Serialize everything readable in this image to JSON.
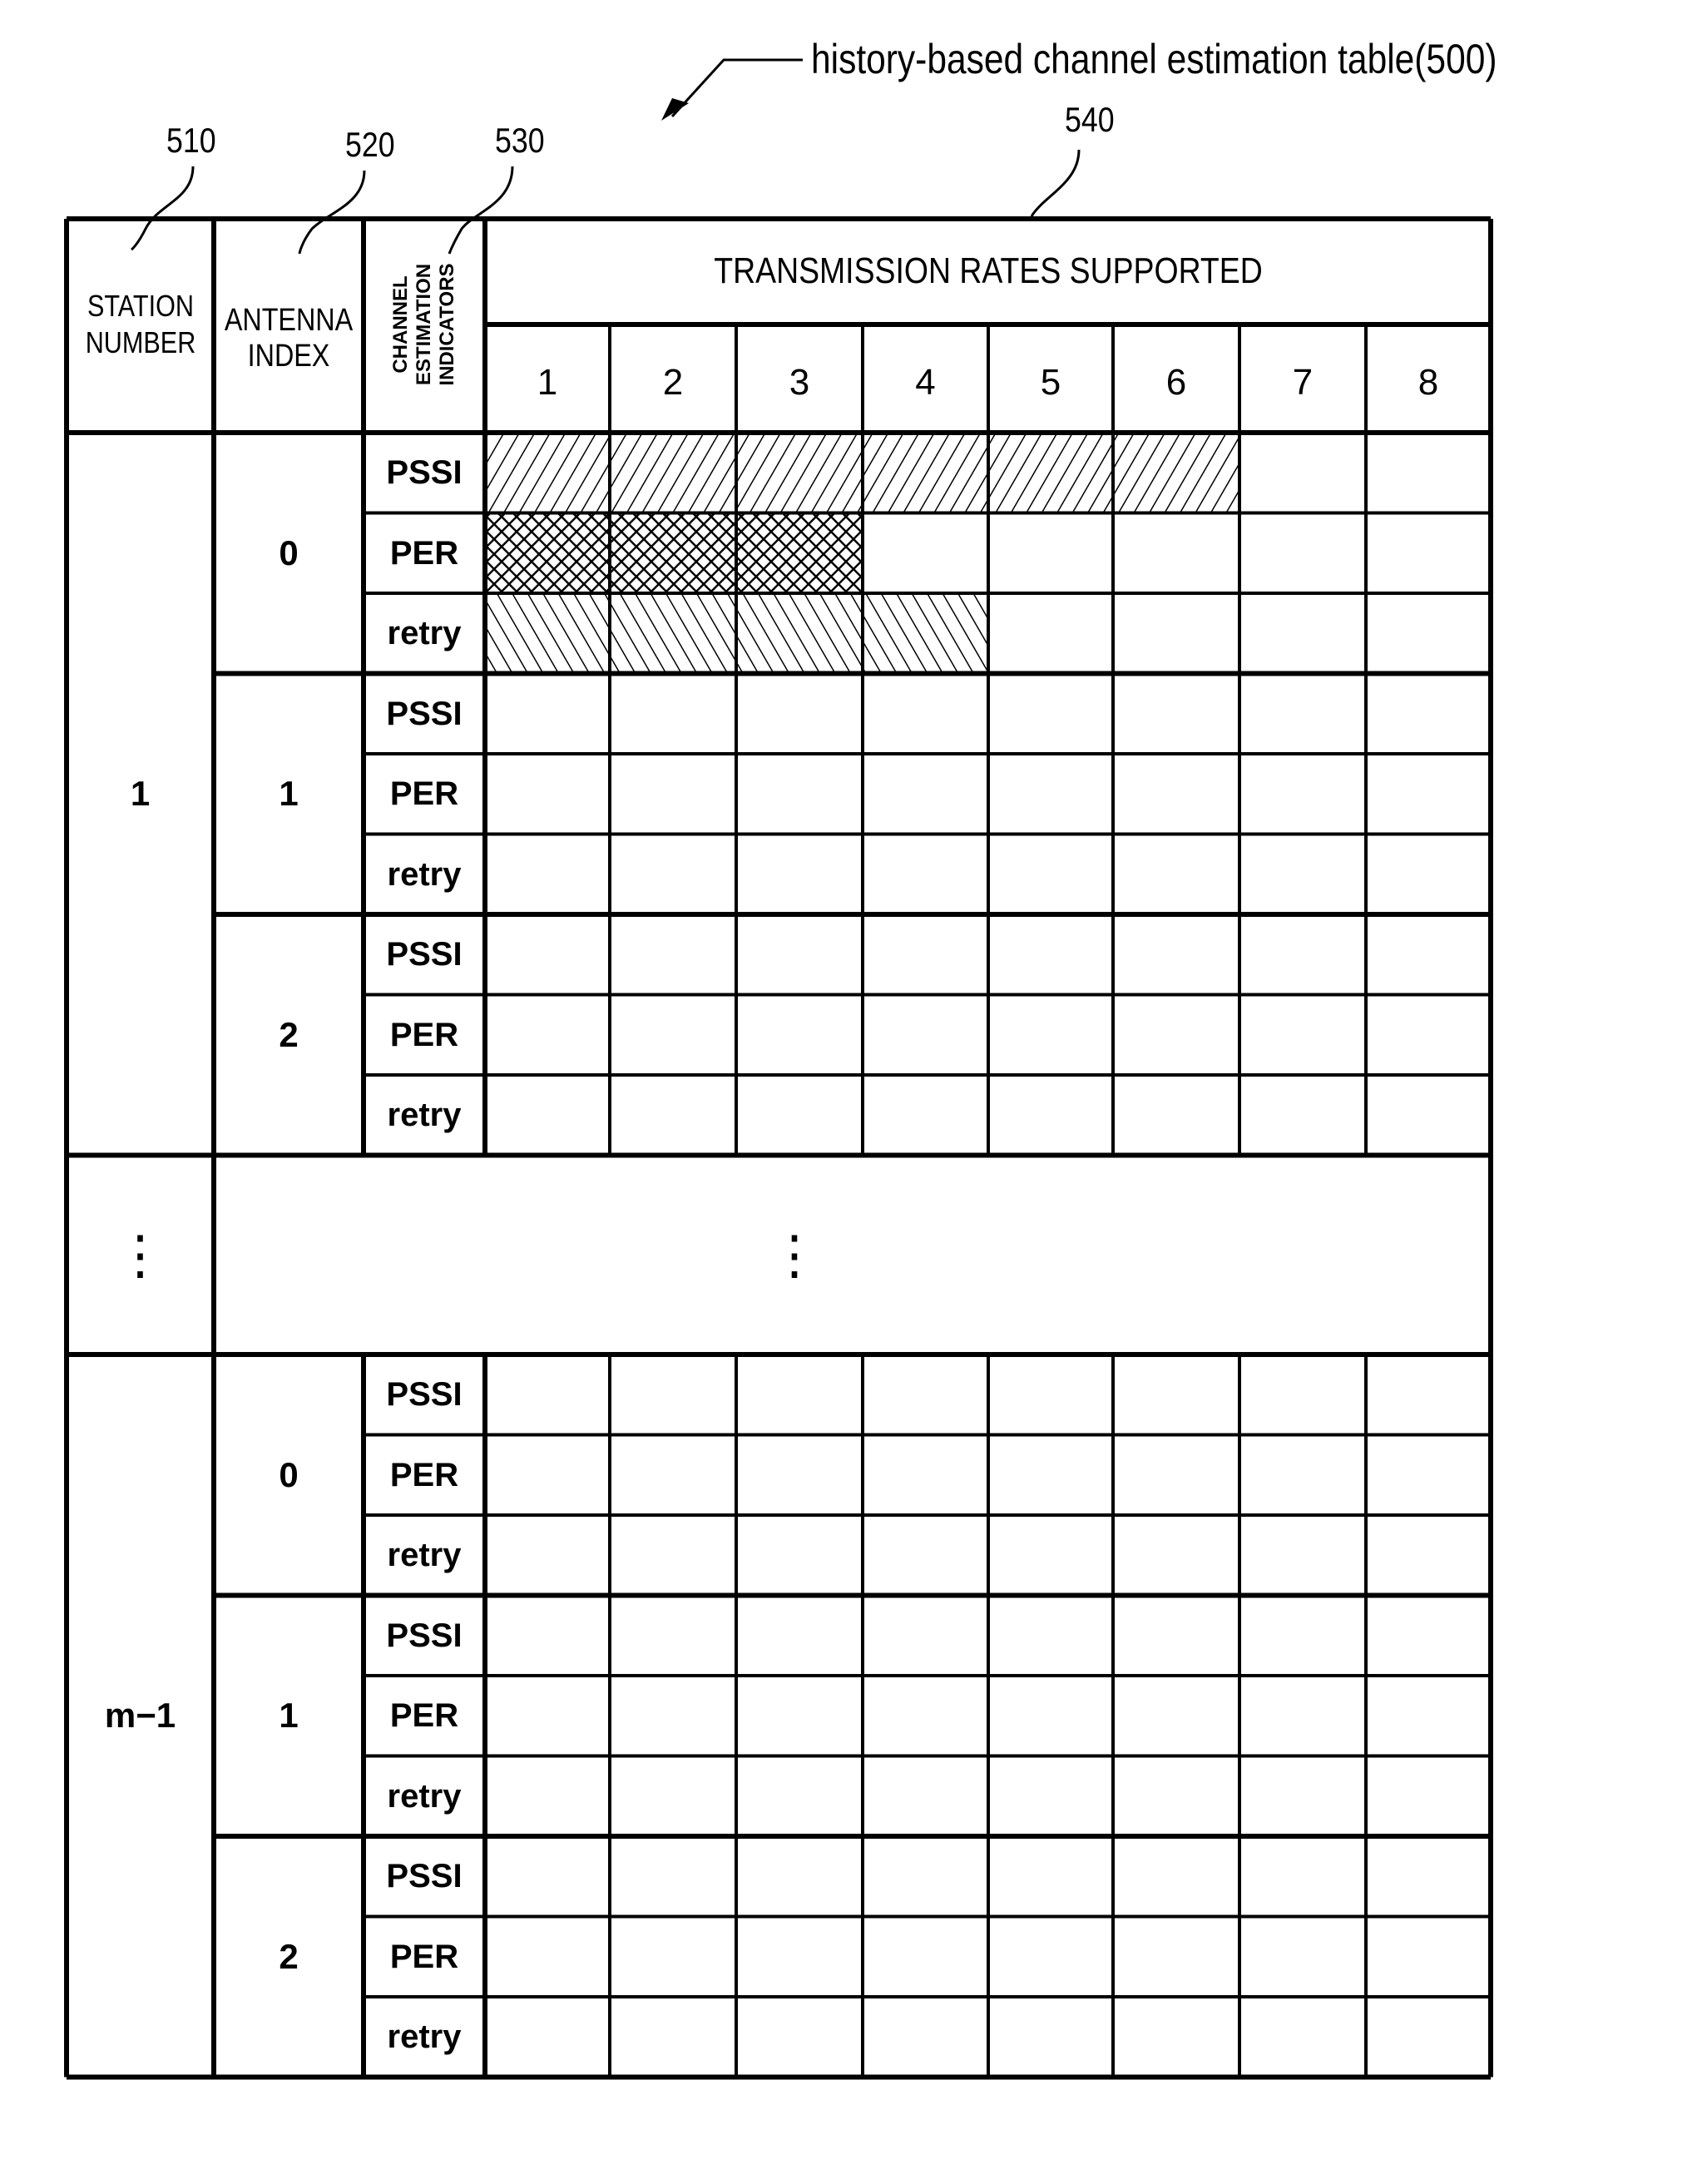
{
  "figure": {
    "title": "history-based channel estimation table(500)",
    "reference_labels": {
      "station": "510",
      "antenna": "520",
      "indicators": "530",
      "rates": "540"
    }
  },
  "table": {
    "headers": {
      "station": [
        "STATION",
        "NUMBER"
      ],
      "antenna": [
        "ANTENNA",
        "INDEX"
      ],
      "indicators": [
        "CHANNEL",
        "ESTIMATION",
        "INDICATORS"
      ],
      "rates_title": "TRANSMISSION RATES SUPPORTED",
      "rates": [
        "1",
        "2",
        "3",
        "4",
        "5",
        "6",
        "7",
        "8"
      ]
    },
    "indicator_names": [
      "PSSI",
      "PER",
      "retry"
    ],
    "ellipsis": "⋮",
    "stations": [
      {
        "label": "1",
        "antennas": [
          {
            "index": "0",
            "filled_rates": {
              "PSSI": 6,
              "PER": 3,
              "retry": 4
            }
          },
          {
            "index": "1",
            "filled_rates": {
              "PSSI": 0,
              "PER": 0,
              "retry": 0
            }
          },
          {
            "index": "2",
            "filled_rates": {
              "PSSI": 0,
              "PER": 0,
              "retry": 0
            }
          }
        ]
      },
      {
        "label": "m−1",
        "antennas": [
          {
            "index": "0",
            "filled_rates": {
              "PSSI": 0,
              "PER": 0,
              "retry": 0
            }
          },
          {
            "index": "1",
            "filled_rates": {
              "PSSI": 0,
              "PER": 0,
              "retry": 0
            }
          },
          {
            "index": "2",
            "filled_rates": {
              "PSSI": 0,
              "PER": 0,
              "retry": 0
            }
          }
        ]
      }
    ],
    "fill_patterns": {
      "PSSI": "forward-hatch",
      "PER": "cross-hatch",
      "retry": "back-hatch"
    }
  }
}
